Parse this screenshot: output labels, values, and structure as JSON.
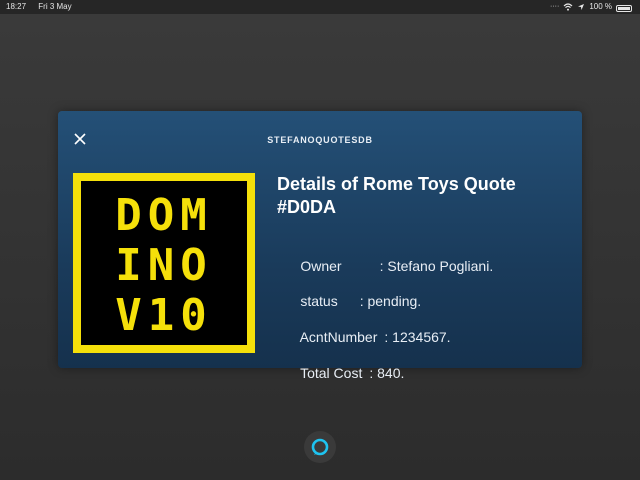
{
  "status_bar": {
    "time": "18:27",
    "date": "Fri 3 May",
    "battery_text": "100 %"
  },
  "card": {
    "header": "STEFANOQUOTESDB",
    "logo_lines": [
      "DOM",
      "INO",
      "V10"
    ],
    "title": "Details of Rome Toys Quote #D0DA",
    "rows": [
      {
        "label": "Owner",
        "value": ": Stefano Pogliani."
      },
      {
        "label": "status",
        "value": ": pending."
      },
      {
        "label": "AcntNumber",
        "value": ": 1234567."
      },
      {
        "label": "Total Cost",
        "value": ": 840."
      }
    ]
  },
  "colors": {
    "card_top": "#245077",
    "card_bottom": "#15314d",
    "logo_yellow": "#f5e00a",
    "alexa_ring": "#1ec3f0"
  },
  "icons": [
    "close-icon",
    "wifi-icon",
    "location-icon",
    "battery-icon",
    "alexa-icon"
  ]
}
